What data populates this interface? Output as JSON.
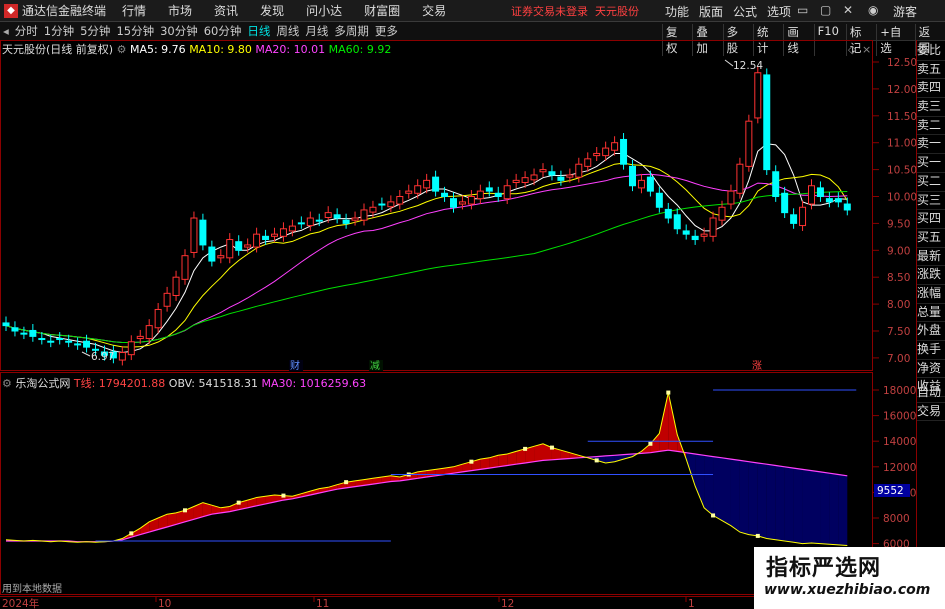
{
  "app": {
    "title": "通达信金融终端",
    "menu": [
      "行情",
      "市场",
      "资讯",
      "发现",
      "问小达",
      "财富圈",
      "交易"
    ],
    "notice": "证券交易未登录",
    "stock_tag": "天元股份",
    "right_menu": [
      "功能",
      "版面",
      "公式",
      "选项"
    ],
    "guest": "游客"
  },
  "periods": {
    "items": [
      "分时",
      "1分钟",
      "5分钟",
      "15分钟",
      "30分钟",
      "60分钟",
      "日线",
      "周线",
      "月线",
      "多周期",
      "更多"
    ],
    "active": "日线",
    "tools": [
      "复权",
      "叠加",
      "多股",
      "统计",
      "画线",
      "F10",
      "标记",
      "+自选",
      "返回"
    ]
  },
  "price_panel": {
    "name": "天元股份(日线 前复权)",
    "ma": [
      {
        "label": "MA5: 9.76",
        "color": "#ffffff"
      },
      {
        "label": "MA10: 9.80",
        "color": "#ffff00"
      },
      {
        "label": "MA20: 10.01",
        "color": "#ff40ff"
      },
      {
        "label": "MA60: 9.92",
        "color": "#00e000"
      }
    ],
    "high_label": "12.54",
    "low_label": "6.97",
    "axis_ticks": [
      "12.50",
      "12.00",
      "11.50",
      "11.00",
      "10.50",
      "10.00",
      "9.50",
      "9.00",
      "8.50",
      "8.00",
      "7.50",
      "7.00"
    ],
    "markers": [
      {
        "text": "财",
        "color": "#6090ff"
      },
      {
        "text": "减",
        "color": "#40d040"
      },
      {
        "text": "涨",
        "color": "#ff4040"
      }
    ]
  },
  "indicator_panel": {
    "name": "乐淘公式网",
    "values": [
      {
        "label": "T线: 1794201.88",
        "color": "#ff4040"
      },
      {
        "label": "OBV: 541518.31",
        "color": "#dddddd"
      },
      {
        "label": "MA30: 1016259.63",
        "color": "#ff40ff"
      }
    ],
    "axis_ticks": [
      "18000",
      "16000",
      "14000",
      "12000",
      "10000",
      "8000",
      "6000"
    ],
    "axis_highlight": "9552",
    "bottom_label": "用到本地数据"
  },
  "date_axis": [
    "2024年",
    "10",
    "11",
    "12",
    "1"
  ],
  "right_panel": [
    "委比",
    "卖五",
    "卖四",
    "卖三",
    "卖二",
    "卖一",
    "买一",
    "买二",
    "买三",
    "买四",
    "买五",
    "最新",
    "涨跌",
    "涨幅",
    "总量",
    "外盘",
    "换手",
    "净资",
    "收益"
  ],
  "right_panel_bottom": [
    "自动",
    "交易"
  ],
  "watermark": {
    "line1": "指标严选网",
    "line2": "www.xuezhibiao.com"
  },
  "colors": {
    "up": "#ff3232",
    "down": "#00ffff",
    "ma5": "#ffffff",
    "ma10": "#ffff00",
    "ma20": "#ff40ff",
    "ma60": "#00e000",
    "fill_up": "#c00000",
    "fill_down": "#000060"
  },
  "chart_data": [
    {
      "type": "candlestick",
      "title": "天元股份(日线 前复权)",
      "ylim": [
        6.8,
        12.8
      ],
      "ylabel": "",
      "annotations": [
        {
          "text": "12.54",
          "kind": "high"
        },
        {
          "text": "6.97",
          "kind": "low"
        }
      ]
    },
    {
      "type": "area",
      "title": "乐淘公式网",
      "ylim": [
        5000,
        19000
      ],
      "series": [
        {
          "name": "T线"
        },
        {
          "name": "OBV"
        },
        {
          "name": "MA30"
        }
      ],
      "axis_highlight": 9552
    }
  ]
}
